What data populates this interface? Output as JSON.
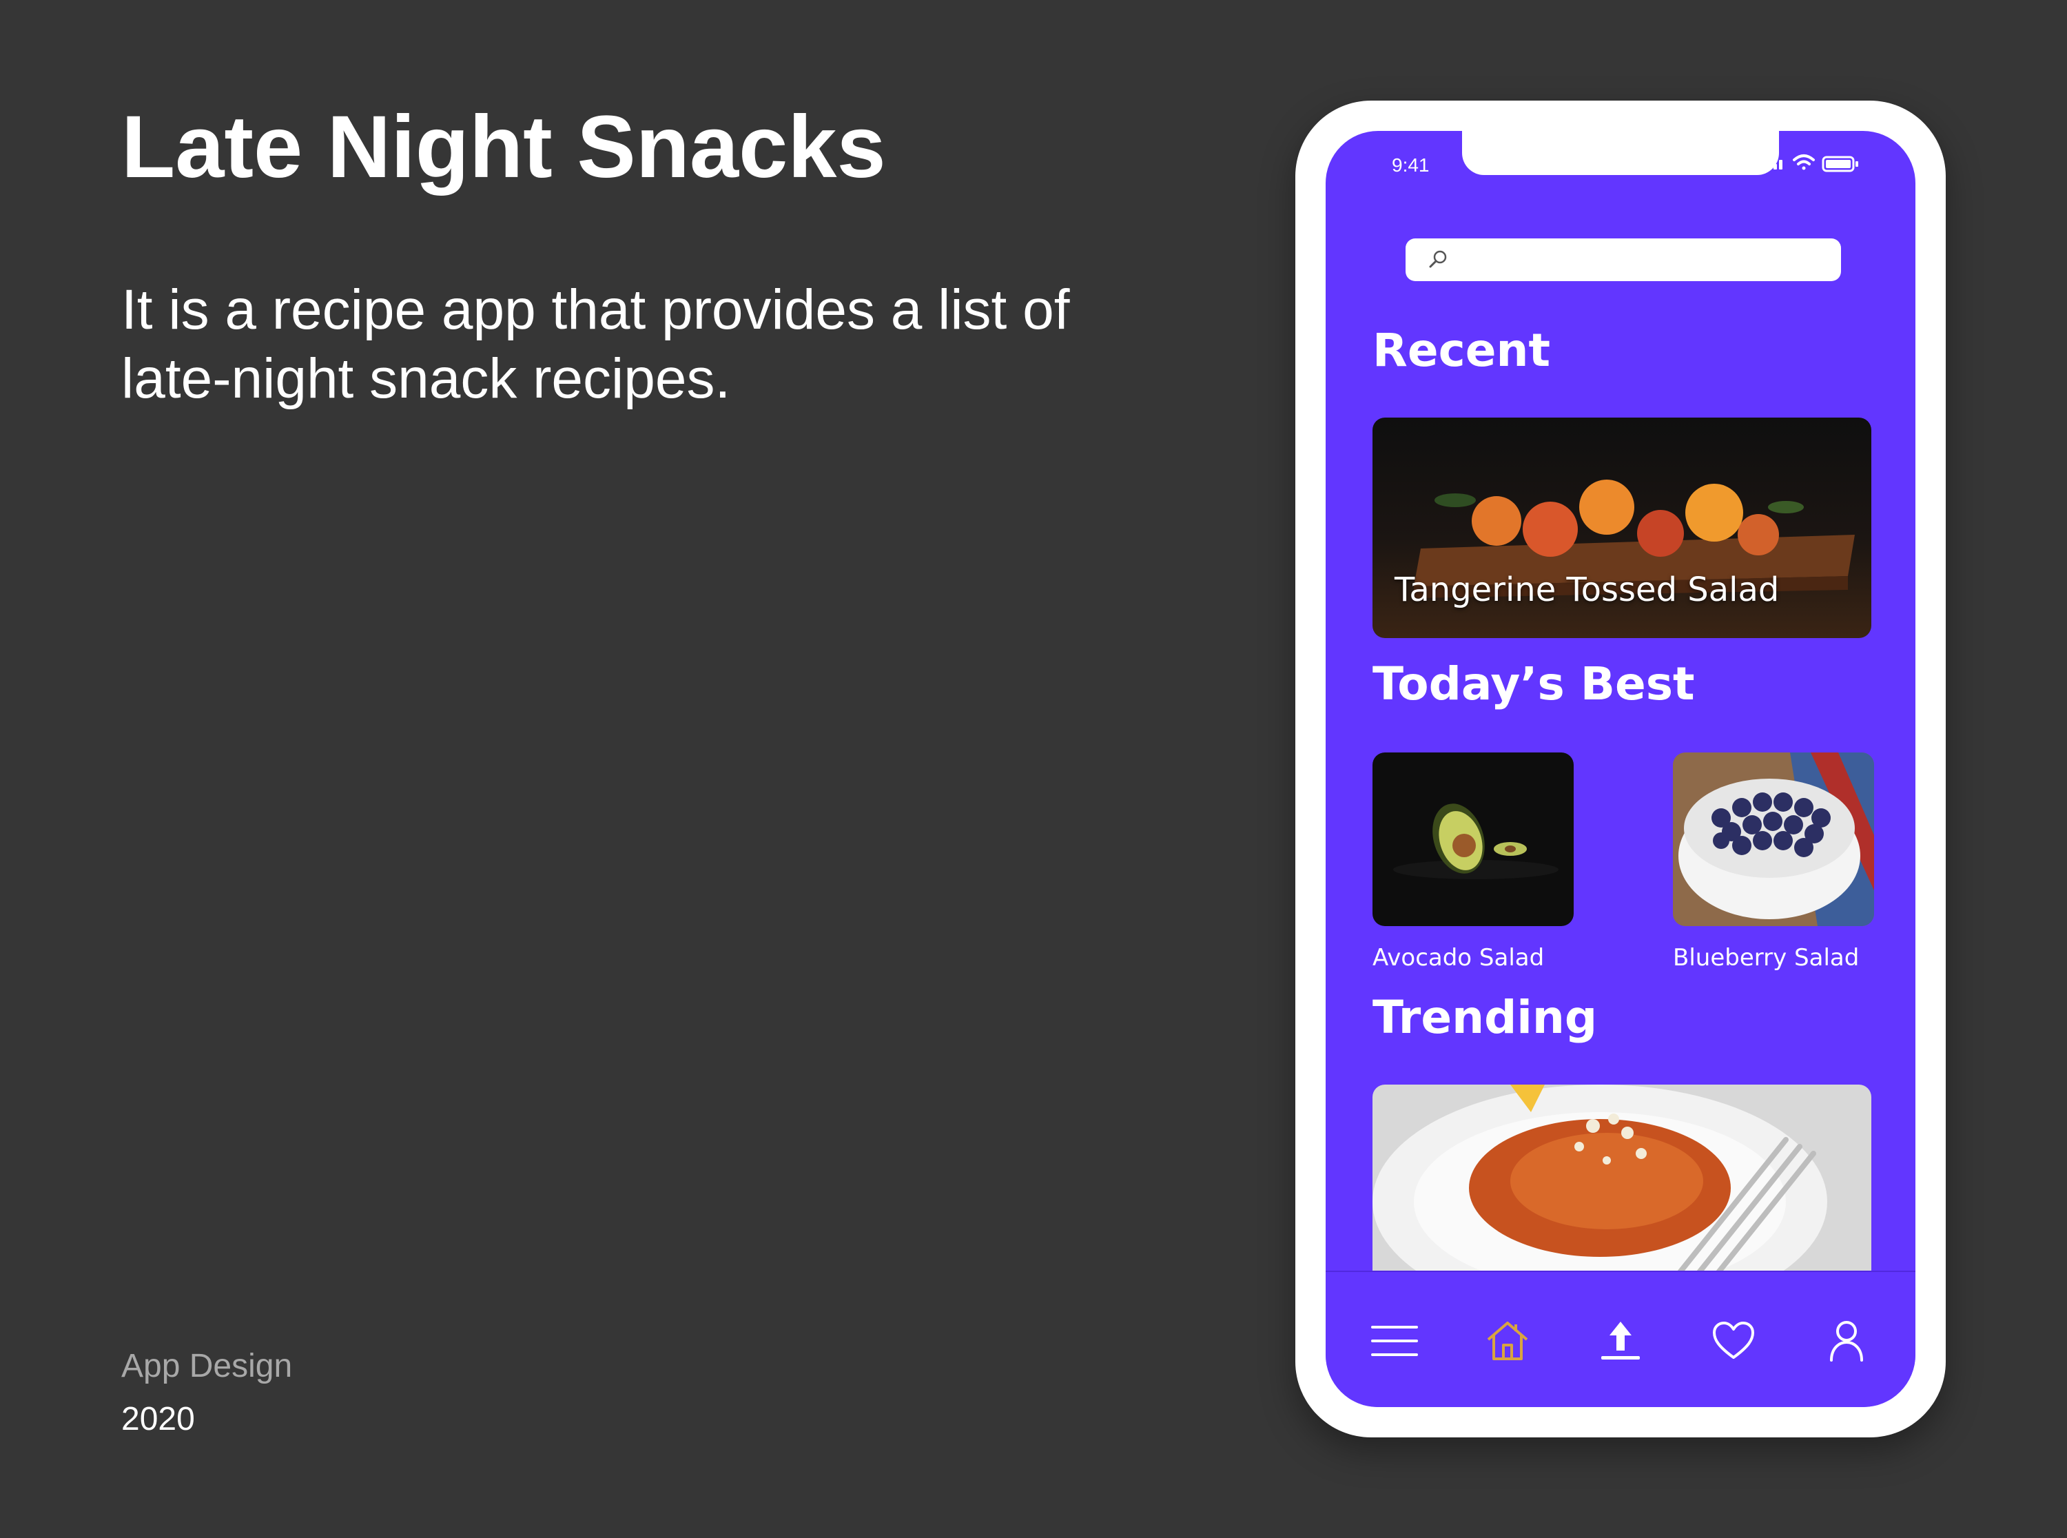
{
  "slide": {
    "title": "Late Night Snacks",
    "description": "It is a recipe app that provides a list of late-night snack recipes.",
    "category": "App Design",
    "year": "2020"
  },
  "phone": {
    "status_time": "9:41",
    "search": {
      "placeholder": "",
      "icon": "search-icon"
    },
    "sections": {
      "recent": {
        "title": "Recent",
        "card_label": "Tangerine Tossed Salad"
      },
      "todays_best": {
        "title": "Today’s Best",
        "items": [
          {
            "label": "Avocado Salad"
          },
          {
            "label": "Blueberry Salad"
          }
        ]
      },
      "trending": {
        "title": "Trending"
      }
    },
    "tabbar": {
      "items": [
        {
          "icon": "menu-icon",
          "active": false
        },
        {
          "icon": "home-icon",
          "active": true
        },
        {
          "icon": "upload-icon",
          "active": false
        },
        {
          "icon": "heart-icon",
          "active": false
        },
        {
          "icon": "profile-icon",
          "active": false
        }
      ]
    }
  },
  "colors": {
    "background": "#363636",
    "accent": "#6236ff",
    "active_tab": "#d9a441"
  }
}
